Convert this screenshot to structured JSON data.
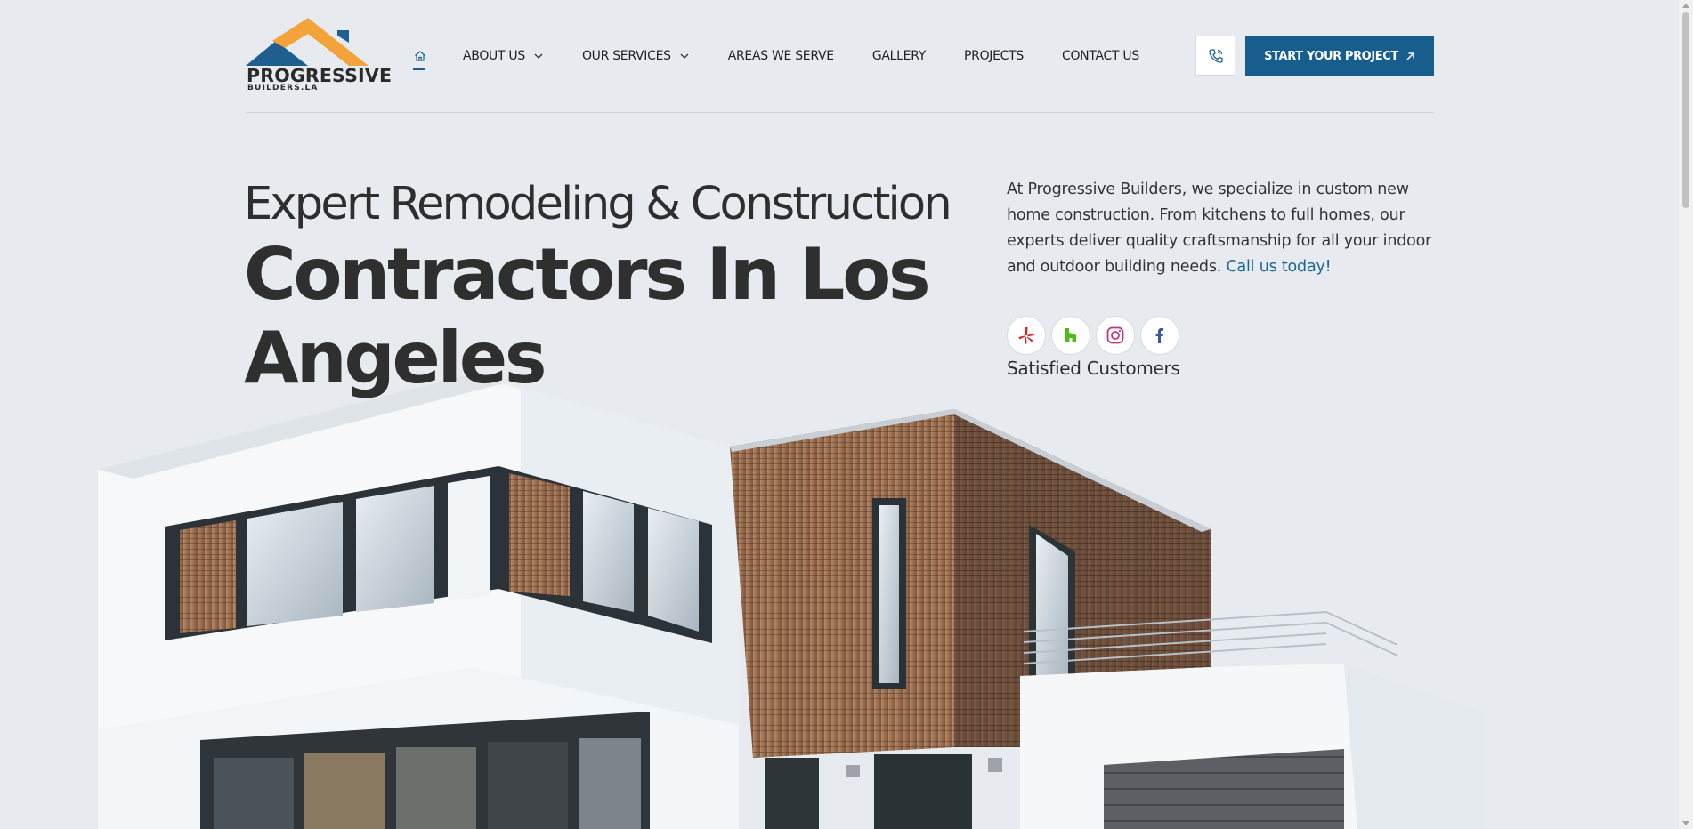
{
  "brand": {
    "logo_word": "PROGRESSIVE",
    "logo_sub": "BUILDERS.LA",
    "colors": {
      "blue": "#1f5f8f",
      "orange": "#f4a23a",
      "dark": "#2a2a2a"
    }
  },
  "nav": {
    "home_icon": "home-icon",
    "items": [
      {
        "label": "ABOUT US",
        "has_dropdown": true
      },
      {
        "label": "OUR SERVICES",
        "has_dropdown": true
      },
      {
        "label": "AREAS WE SERVE",
        "has_dropdown": false
      },
      {
        "label": "GALLERY",
        "has_dropdown": false
      },
      {
        "label": "PROJECTS",
        "has_dropdown": false
      },
      {
        "label": "CONTACT US",
        "has_dropdown": false
      }
    ],
    "phone_icon": "phone-icon",
    "cta_label": "START YOUR PROJECT",
    "cta_icon": "arrow-up-right-icon"
  },
  "hero": {
    "line1": "Expert Remodeling & Construction",
    "line2": "Contractors In Los Angeles",
    "intro_text": "At Progressive Builders, we specialize in custom new home construction. From kitchens to full homes, our experts deliver quality craftsmanship for all your indoor and outdoor building needs. ",
    "intro_link": "Call us today!",
    "socials": [
      {
        "name": "yelp",
        "icon": "yelp-icon",
        "color": "#d32323"
      },
      {
        "name": "houzz",
        "icon": "houzz-icon",
        "color": "#4dbc15"
      },
      {
        "name": "instagram",
        "icon": "instagram-icon",
        "color": "#c13584"
      },
      {
        "name": "facebook",
        "icon": "facebook-icon",
        "color": "#3b5998"
      }
    ],
    "satisfied_label": "Satisfied Customers"
  },
  "theme": {
    "accent": "#175d8e",
    "background": "#e7ebef",
    "text": "#2b2b2b"
  }
}
